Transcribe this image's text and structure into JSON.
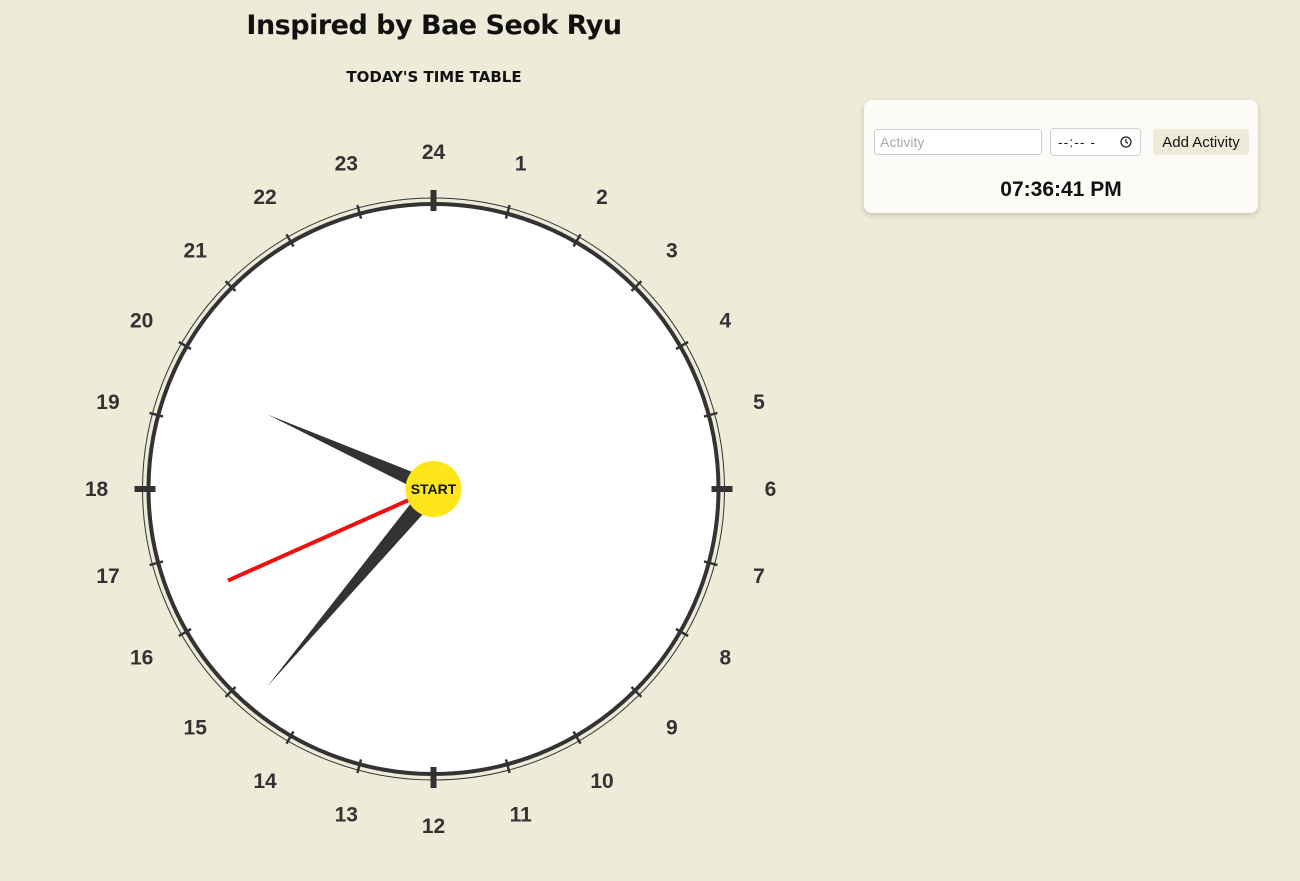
{
  "header": {
    "title": "Inspired by Bae Seok Ryu",
    "subtitle": "TODAY'S TIME TABLE"
  },
  "clock": {
    "hour_labels": [
      "24",
      "1",
      "2",
      "3",
      "4",
      "5",
      "6",
      "7",
      "8",
      "9",
      "10",
      "11",
      "12",
      "13",
      "14",
      "15",
      "16",
      "17",
      "18",
      "19",
      "20",
      "21",
      "22",
      "23"
    ],
    "center_label": "START",
    "current_time": {
      "hours": 19,
      "minutes": 36,
      "seconds": 41
    },
    "colors": {
      "face": "#ffffff",
      "rim": "#333333",
      "hands": "#333333",
      "second_hand": "#ee1111",
      "center": "#fde619",
      "background": "#efebd9"
    }
  },
  "panel": {
    "activity_placeholder": "Activity",
    "activity_value": "",
    "time_value": "--:-- -",
    "add_button_label": "Add Activity",
    "time_display": "07:36:41 PM"
  }
}
